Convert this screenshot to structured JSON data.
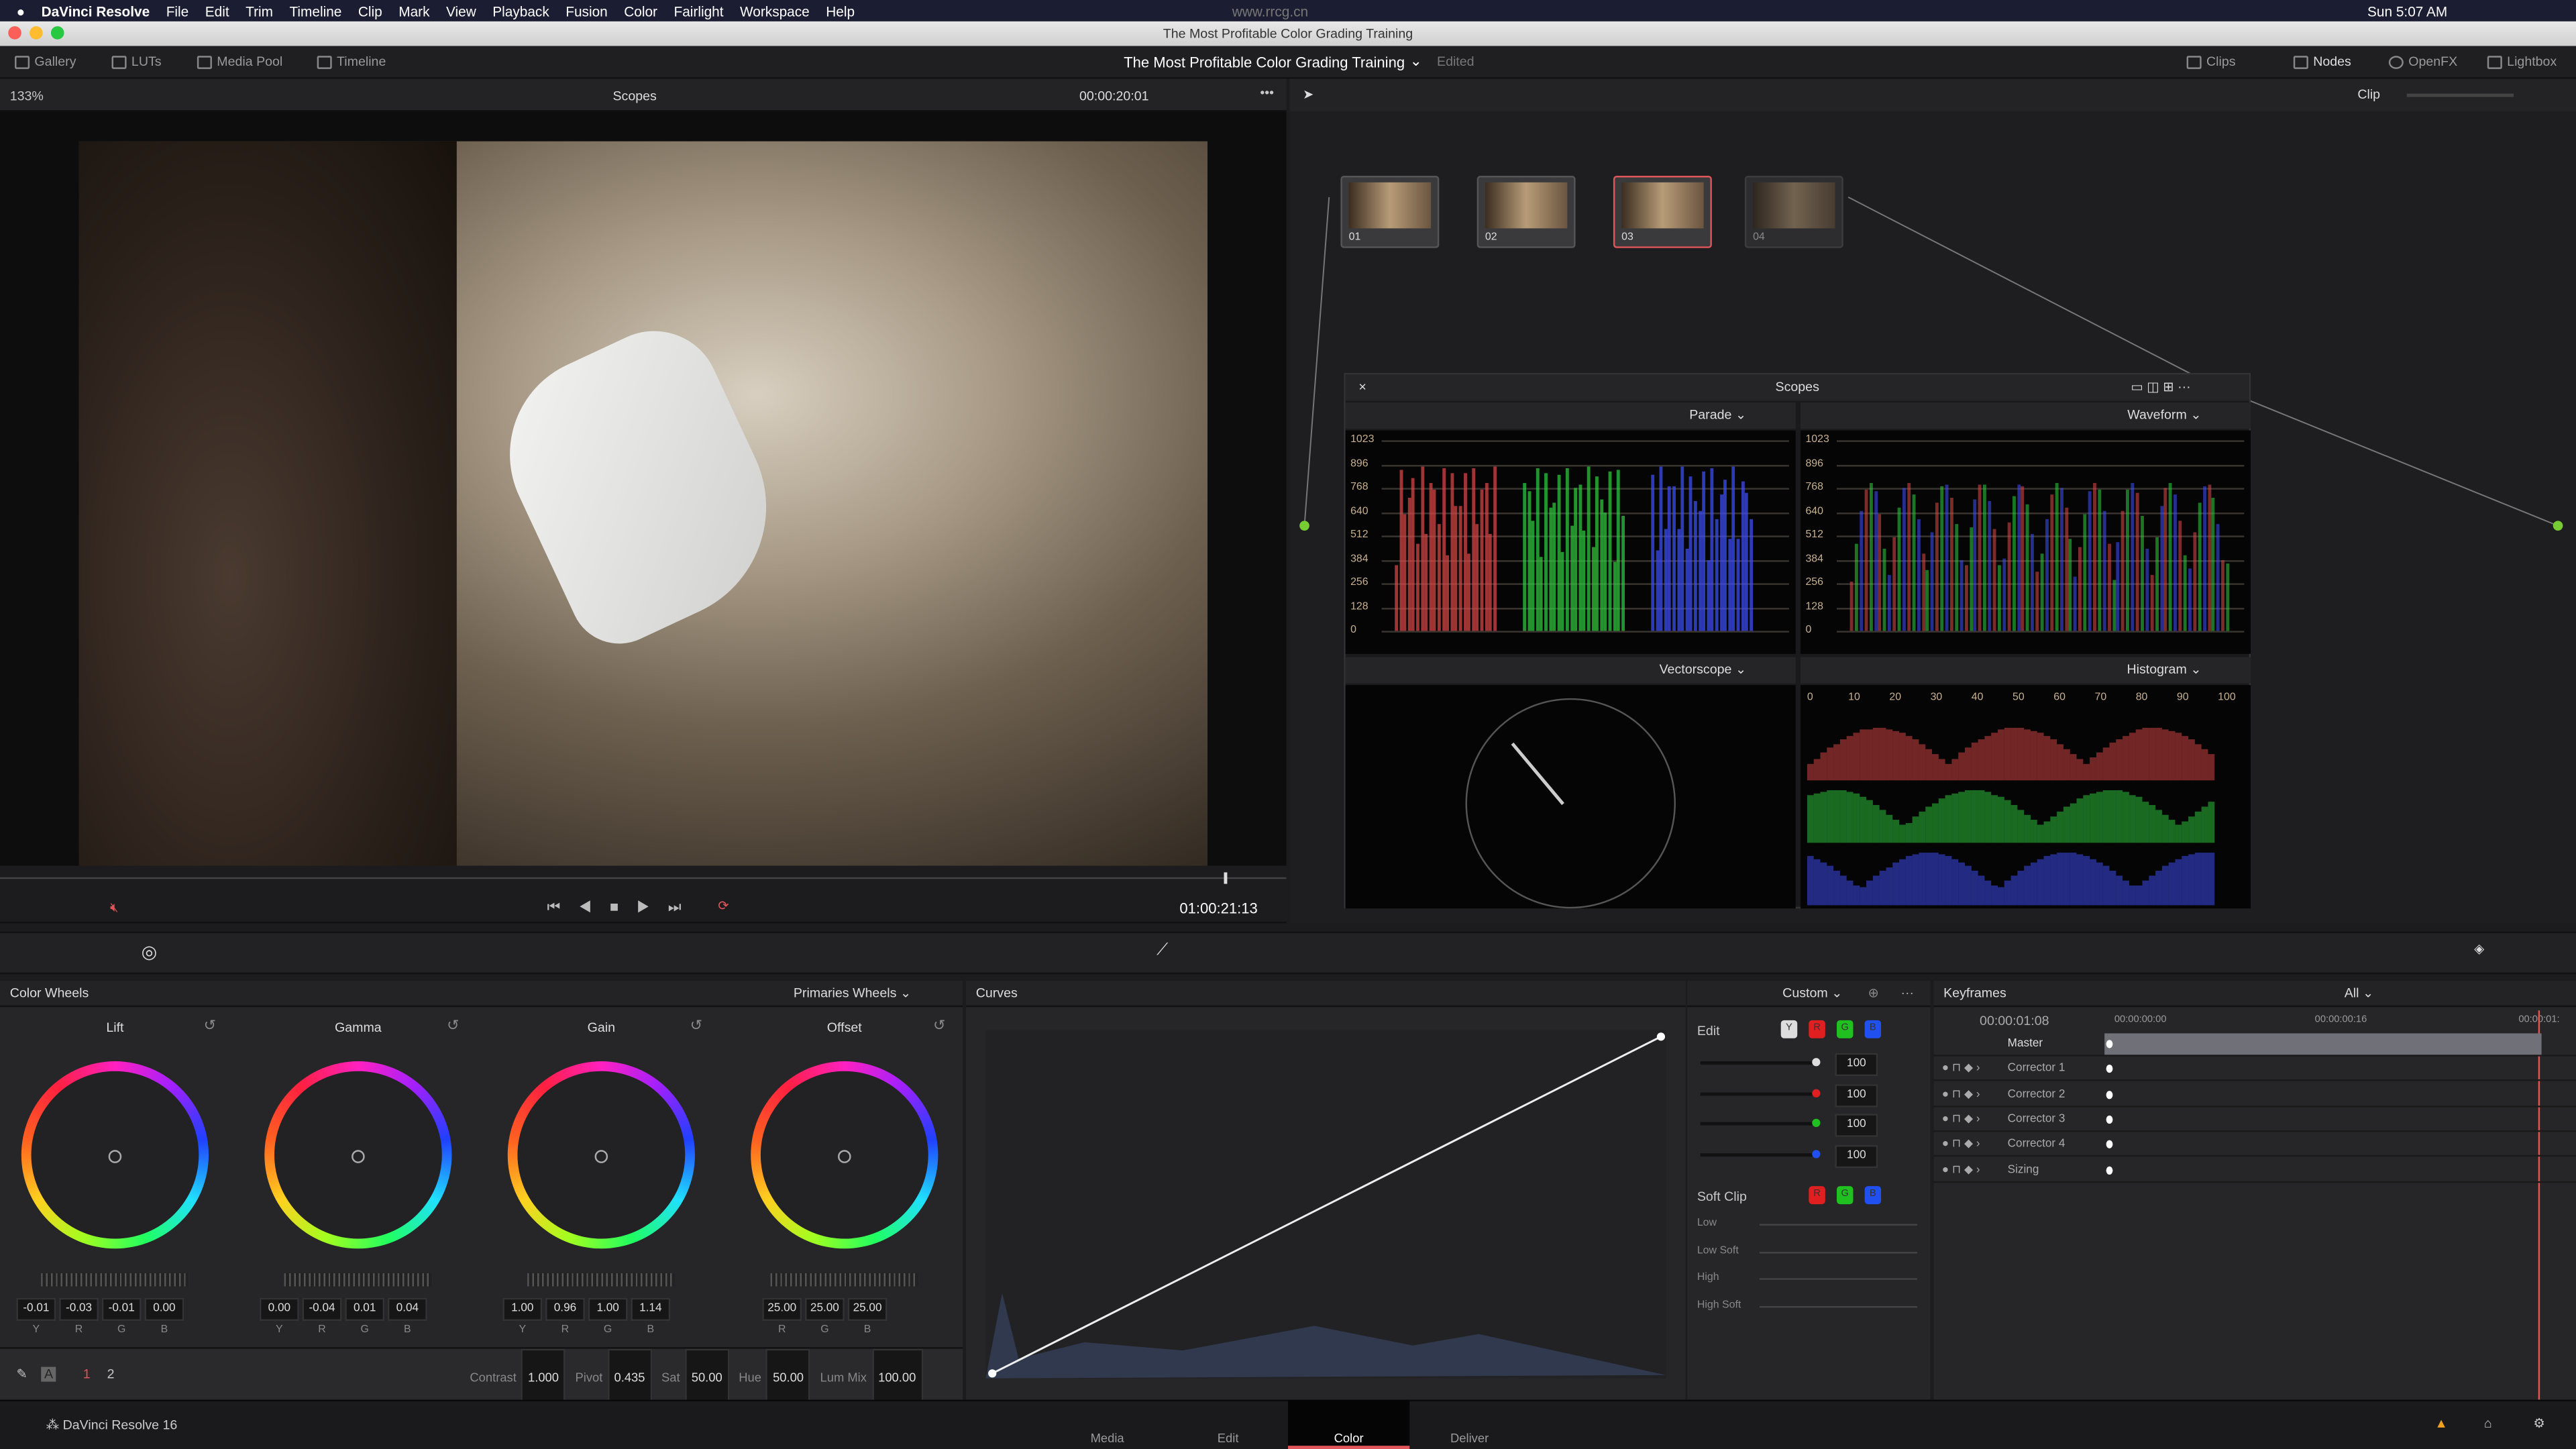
{
  "menubar": {
    "app": "DaVinci Resolve",
    "items": [
      "File",
      "Edit",
      "Trim",
      "Timeline",
      "Clip",
      "Mark",
      "View",
      "Playback",
      "Fusion",
      "Color",
      "Fairlight",
      "Workspace",
      "Help"
    ],
    "clock": "Sun 5:07 AM",
    "watermark": "www.rrcg.cn"
  },
  "window": {
    "title": "The Most Profitable Color Grading Training"
  },
  "toolbar": {
    "left": [
      "Gallery",
      "LUTs",
      "Media Pool",
      "Timeline"
    ],
    "project": "The Most Profitable Color Grading Training",
    "status": "Edited",
    "right": [
      "Clips",
      "Nodes",
      "OpenFX",
      "Lightbox"
    ]
  },
  "viewer": {
    "zoom": "133%",
    "mode": "Scopes",
    "timecode": "00:00:20:01",
    "record_tc": "01:00:21:13"
  },
  "nodes": {
    "mode": "Clip",
    "items": [
      {
        "label": "01"
      },
      {
        "label": "02"
      },
      {
        "label": "03"
      },
      {
        "label": "04"
      }
    ]
  },
  "scopes": {
    "title": "Scopes",
    "tl": "Parade",
    "tr": "Waveform",
    "bl": "Vectorscope",
    "br": "Histogram",
    "yticks": [
      "1023",
      "896",
      "768",
      "640",
      "512",
      "384",
      "256",
      "128",
      "0"
    ],
    "hticks": [
      "0",
      "10",
      "20",
      "30",
      "40",
      "50",
      "60",
      "70",
      "80",
      "90",
      "100"
    ]
  },
  "wheels": {
    "title": "Color Wheels",
    "mode": "Primaries Wheels",
    "items": [
      {
        "name": "Lift",
        "values": [
          "-0.01",
          "-0.03",
          "-0.01",
          "0.00"
        ],
        "channels": [
          "Y",
          "R",
          "G",
          "B"
        ]
      },
      {
        "name": "Gamma",
        "values": [
          "0.00",
          "-0.04",
          "0.01",
          "0.04"
        ],
        "channels": [
          "Y",
          "R",
          "G",
          "B"
        ]
      },
      {
        "name": "Gain",
        "values": [
          "1.00",
          "0.96",
          "1.00",
          "1.14"
        ],
        "channels": [
          "Y",
          "R",
          "G",
          "B"
        ]
      },
      {
        "name": "Offset",
        "values": [
          "25.00",
          "25.00",
          "25.00"
        ],
        "channels": [
          "R",
          "G",
          "B"
        ]
      }
    ],
    "page1": "1",
    "page2": "2",
    "a_label": "A",
    "params": [
      {
        "label": "Contrast",
        "value": "1.000"
      },
      {
        "label": "Pivot",
        "value": "0.435"
      },
      {
        "label": "Sat",
        "value": "50.00"
      },
      {
        "label": "Hue",
        "value": "50.00"
      },
      {
        "label": "Lum Mix",
        "value": "100.00"
      }
    ]
  },
  "curves": {
    "title": "Curves",
    "mode": "Custom",
    "edit_label": "Edit",
    "channel_buttons": [
      "Y",
      "R",
      "G",
      "B"
    ],
    "intensity": [
      "100",
      "100",
      "100",
      "100"
    ],
    "softclip_label": "Soft Clip",
    "softclip_buttons": [
      "R",
      "G",
      "B"
    ],
    "softclip": [
      "Low",
      "Low Soft",
      "High",
      "High Soft"
    ]
  },
  "keyframes": {
    "title": "Keyframes",
    "filter": "All",
    "timecode": "00:00:01:08",
    "ruler": [
      "00:00:00:00",
      "00:00:00:16",
      "00:00:01:"
    ],
    "rows": [
      "Master",
      "Corrector 1",
      "Corrector 2",
      "Corrector 3",
      "Corrector 4",
      "Sizing"
    ]
  },
  "footer": {
    "app": "DaVinci Resolve 16",
    "pages": [
      "Media",
      "Edit",
      "Color",
      "Deliver"
    ],
    "active": "Color"
  },
  "colors": {
    "accent": "#e0555a",
    "menubar": "#1b1d33"
  }
}
